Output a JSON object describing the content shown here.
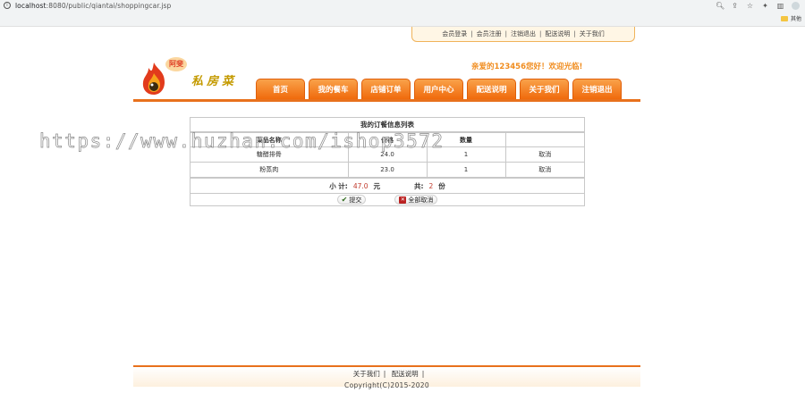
{
  "browser": {
    "url_host": "localhost",
    "url_path": ":8080/public/qiantai/shoppingcar.jsp",
    "bookmark_folder": "其他"
  },
  "toplinks": [
    "会员登录",
    "会员注册",
    "注销退出",
    "配送说明",
    "关于我们"
  ],
  "logo": {
    "badge": "阿斐",
    "brand": "私房菜"
  },
  "welcome": "亲爱的123456您好！欢迎光临!",
  "nav": [
    "首页",
    "我的餐车",
    "店铺订单",
    "用户中心",
    "配送说明",
    "关于我们",
    "注销退出"
  ],
  "order": {
    "title": "我的订餐信息列表",
    "headers": [
      "菜品名称",
      "价格",
      "数量",
      ""
    ],
    "rows": [
      {
        "name": "糖醋排骨",
        "price": "24.0",
        "qty": "1",
        "action": "取消"
      },
      {
        "name": "粉蒸肉",
        "price": "23.0",
        "qty": "1",
        "action": "取消"
      }
    ],
    "subtotal_label": "小 计:",
    "subtotal_value": "47.0",
    "subtotal_unit": "元",
    "count_label": "共:",
    "count_value": "2",
    "count_unit": "份",
    "submit_label": "提交",
    "cancel_all_label": "全部取消"
  },
  "watermark": "https://www.huzhan.com/ishop3572",
  "footer": {
    "links": [
      "关于我们",
      "配送说明"
    ],
    "copyright": "Copyright(C)2015-2020"
  },
  "colors": {
    "accent": "#f06a0c",
    "welcome": "#f08c1e",
    "price_red": "#c0392b"
  }
}
